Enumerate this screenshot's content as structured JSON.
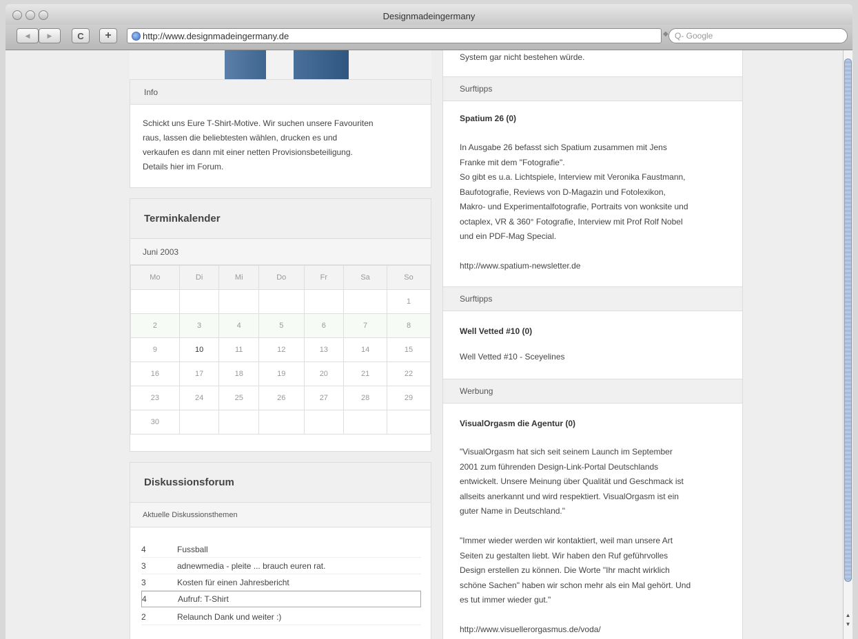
{
  "browser": {
    "title": "Designmadeingermany",
    "url": "http://www.designmadeingermany.de",
    "search_placeholder": "Q- Google",
    "back_label": "◀",
    "forward_label": "▶",
    "reload_label": "C",
    "add_label": "+"
  },
  "left": {
    "info": {
      "heading": "Info",
      "text_lines": [
        "Schickt uns Eure T-Shirt-Motive. Wir suchen unsere Favouriten",
        "raus, lassen die beliebtesten wählen, drucken es und",
        "verkaufen es dann mit einer netten Provisionsbeteiligung.",
        "Details hier im Forum."
      ]
    },
    "calendar": {
      "title": "Terminkalender",
      "month": "Juni 2003",
      "weekdays": [
        "Mo",
        "Di",
        "Mi",
        "Do",
        "Fr",
        "Sa",
        "So"
      ],
      "weeks": [
        [
          "",
          "",
          "",
          "",
          "",
          "",
          "1"
        ],
        [
          "2",
          "3",
          "4",
          "5",
          "6",
          "7",
          "8"
        ],
        [
          "9",
          "10",
          "11",
          "12",
          "13",
          "14",
          "15"
        ],
        [
          "16",
          "17",
          "18",
          "19",
          "20",
          "21",
          "22"
        ],
        [
          "23",
          "24",
          "25",
          "26",
          "27",
          "28",
          "29"
        ],
        [
          "30",
          "",
          "",
          "",
          "",
          "",
          ""
        ]
      ],
      "today": "10"
    },
    "forum": {
      "title": "Diskussionsforum",
      "subtitle": "Aktuelle Diskussionsthemen",
      "topics": [
        {
          "count": "4",
          "title": "Fussball"
        },
        {
          "count": "3",
          "title": "adnewmedia - pleite ... brauch euren rat."
        },
        {
          "count": "3",
          "title": "Kosten für einen Jahresbericht"
        },
        {
          "count": "4",
          "title": "Aufruf: T-Shirt"
        },
        {
          "count": "2",
          "title": "Relaunch Dank und weiter :)"
        }
      ]
    }
  },
  "right": {
    "top_text": "System gar nicht bestehen würde.",
    "sections": [
      {
        "label": "Surftipps",
        "title": "Spatium 26 (0)",
        "lines": [
          "In Ausgabe 26 befasst sich Spatium zusammen mit Jens",
          "Franke mit dem \"Fotografie\".",
          "So gibt es u.a. Lichtspiele, Interview mit Veronika Faustmann,",
          "Baufotografie, Reviews von D-Magazin und Fotolexikon,",
          "Makro- und Experimentalfotografie, Portraits von wonksite und",
          "octaplex, VR & 360° Fotografie, Interview mit Prof Rolf Nobel",
          "und ein PDF-Mag Special.",
          "",
          "http://www.spatium-newsletter.de"
        ]
      },
      {
        "label": "Surftipps",
        "title": "Well Vetted #10 (0)",
        "lines": [
          "Well Vetted #10 - Sceyelines"
        ]
      },
      {
        "label": "Werbung",
        "title": "VisualOrgasm die Agentur (0)",
        "lines": [
          "\"VisualOrgasm hat sich seit seinem Launch im September",
          "2001 zum führenden Design-Link-Portal Deutschlands",
          "entwickelt. Unsere Meinung über Qualität und Geschmack ist",
          "allseits anerkannt und wird respektiert. VisualOrgasm ist ein",
          "guter Name in Deutschland.\"",
          "",
          "\"Immer wieder werden wir kontaktiert, weil man unsere Art",
          "Seiten zu gestalten liebt. Wir haben den Ruf geführvolles",
          "Design erstellen zu können. Die Worte \"Ihr macht wirklich",
          "schöne Sachen\" haben wir schon mehr als ein Mal gehört. Und",
          "es tut immer wieder gut.\"",
          "",
          "http://www.visuellerorgasmus.de/voda/"
        ]
      }
    ]
  }
}
